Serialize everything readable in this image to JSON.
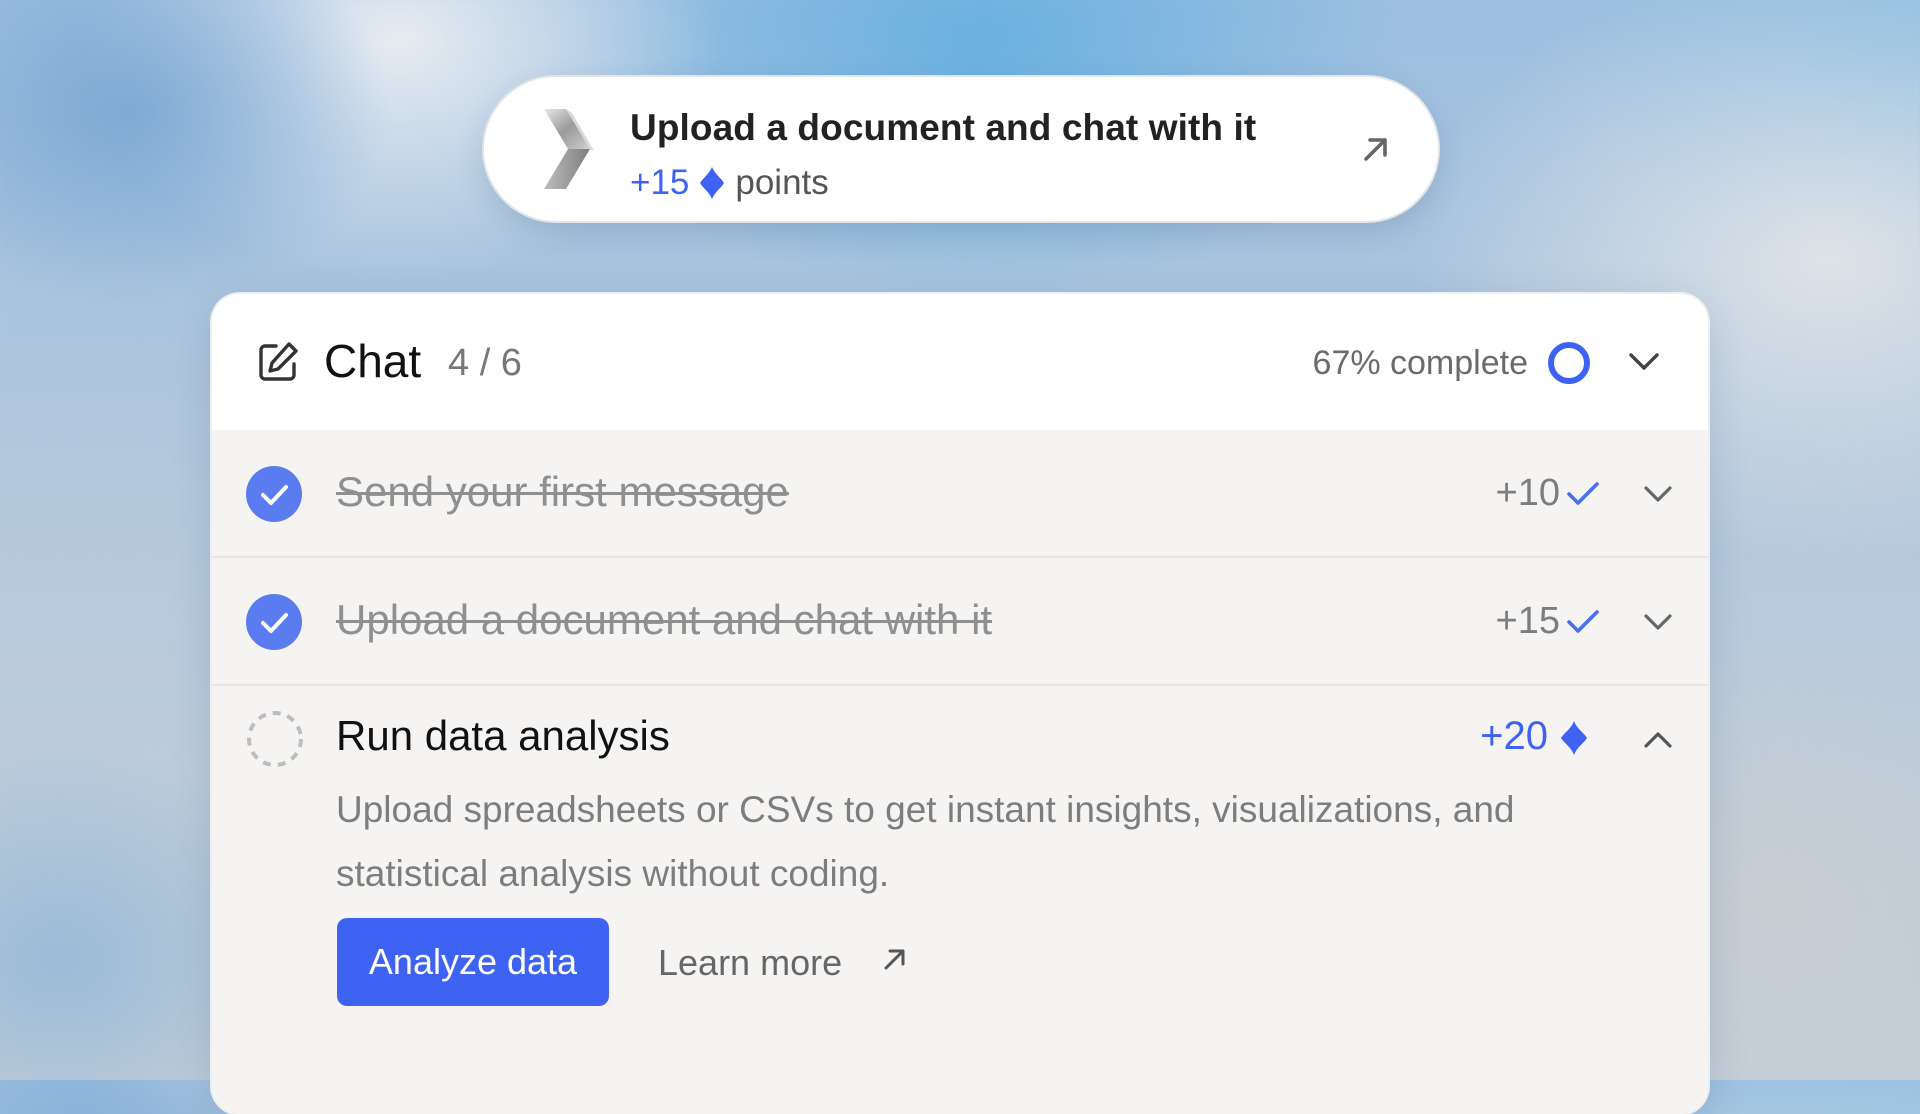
{
  "notification": {
    "title": "Upload a document and chat with it",
    "points_value": "+15",
    "points_label": "points",
    "icons": {
      "logo": "app-logo-chevron",
      "open": "arrow-up-right-icon",
      "points": "diamond-icon"
    }
  },
  "section": {
    "title": "Chat",
    "count": "4 / 6",
    "progress_text": "67% complete",
    "progress_fraction": 0.67,
    "expanded": true
  },
  "tasks": [
    {
      "title": "Send your first message",
      "points": "+10",
      "status": "completed"
    },
    {
      "title": "Upload a document and chat with it",
      "points": "+15",
      "status": "completed"
    },
    {
      "title": "Run data analysis",
      "points": "+20",
      "status": "pending",
      "description": "Upload spreadsheets or CSVs to get instant insights, visualizations, and statistical analysis without coding.",
      "primary_action": "Analyze data",
      "secondary_action": "Learn more"
    }
  ],
  "colors": {
    "accent": "#3e63f2",
    "check": "#5b7cf0",
    "muted_text": "#8f8f8f",
    "card_bg": "#f5f4f3"
  }
}
